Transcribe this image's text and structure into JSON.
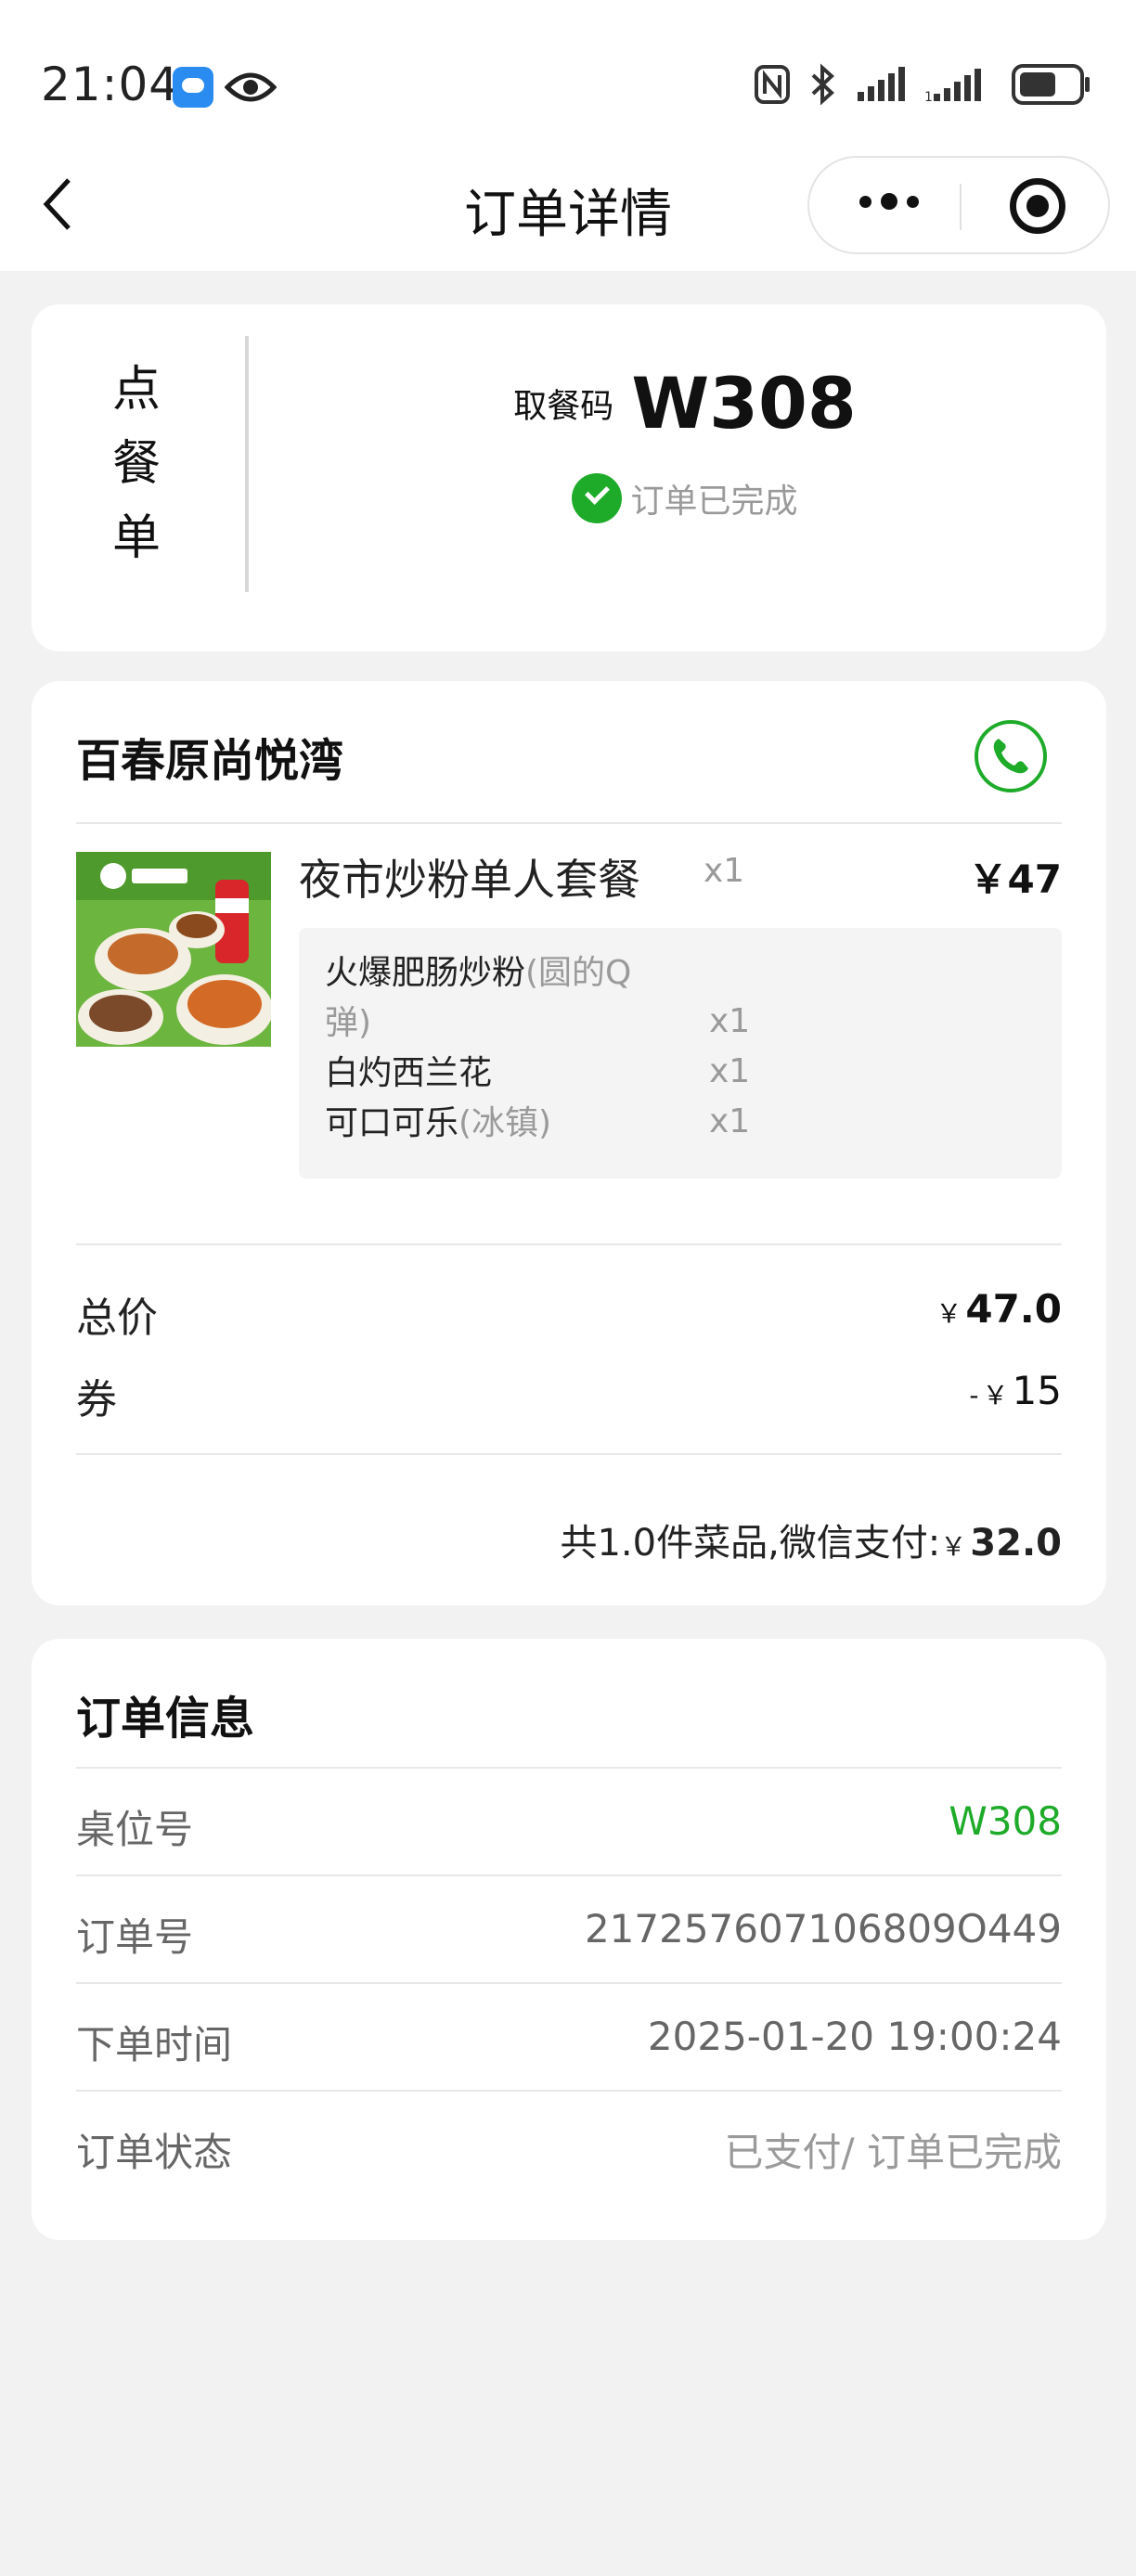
{
  "status_bar": {
    "time": "21:04",
    "icons": [
      "weather-icon",
      "eye-icon",
      "nfc-icon",
      "bluetooth-icon",
      "signal-icon",
      "signal-icon",
      "battery-icon"
    ]
  },
  "nav": {
    "title": "订单详情",
    "back_icon": "chevron-left-icon",
    "more_icon": "more-dots-icon",
    "close_icon": "target-icon"
  },
  "order_summary": {
    "type_label_chars": [
      "点",
      "餐",
      "单"
    ],
    "pickup_label": "取餐码",
    "pickup_code": "W308",
    "status": "订单已完成"
  },
  "store": {
    "name": "百春原尚悦湾",
    "phone_icon": "phone-icon"
  },
  "item": {
    "name": "夜市炒粉单人套餐",
    "qty": "x1",
    "price": "￥47",
    "sub_items": [
      {
        "name": "火爆肥肠炒粉",
        "note_line1": "(圆的Q",
        "note_line2": "弹)",
        "qty": "x1"
      },
      {
        "name": "白灼西兰花",
        "note": "",
        "qty": "x1"
      },
      {
        "name": "可口可乐",
        "note": "(冰镇)",
        "qty": "x1"
      }
    ]
  },
  "totals": {
    "total_label": "总价",
    "total_currency": "￥",
    "total_value": "47.0",
    "coupon_label": "券",
    "coupon_prefix": "-",
    "coupon_currency": "￥",
    "coupon_value": "15",
    "pay_text": "共1.0件菜品,微信支付:",
    "pay_currency": "￥",
    "pay_value": "32.0"
  },
  "order_info": {
    "title": "订单信息",
    "rows": [
      {
        "label": "桌位号",
        "value": "W308"
      },
      {
        "label": "订单号",
        "value": "217257607106809O449"
      },
      {
        "label": "下单时间",
        "value": "2025-01-20 19:00:24"
      },
      {
        "label": "订单状态",
        "value": "已支付/ 订单已完成"
      }
    ]
  },
  "colors": {
    "accent_green": "#1fab2a",
    "background": "#f2f2f2",
    "card": "#ffffff"
  }
}
